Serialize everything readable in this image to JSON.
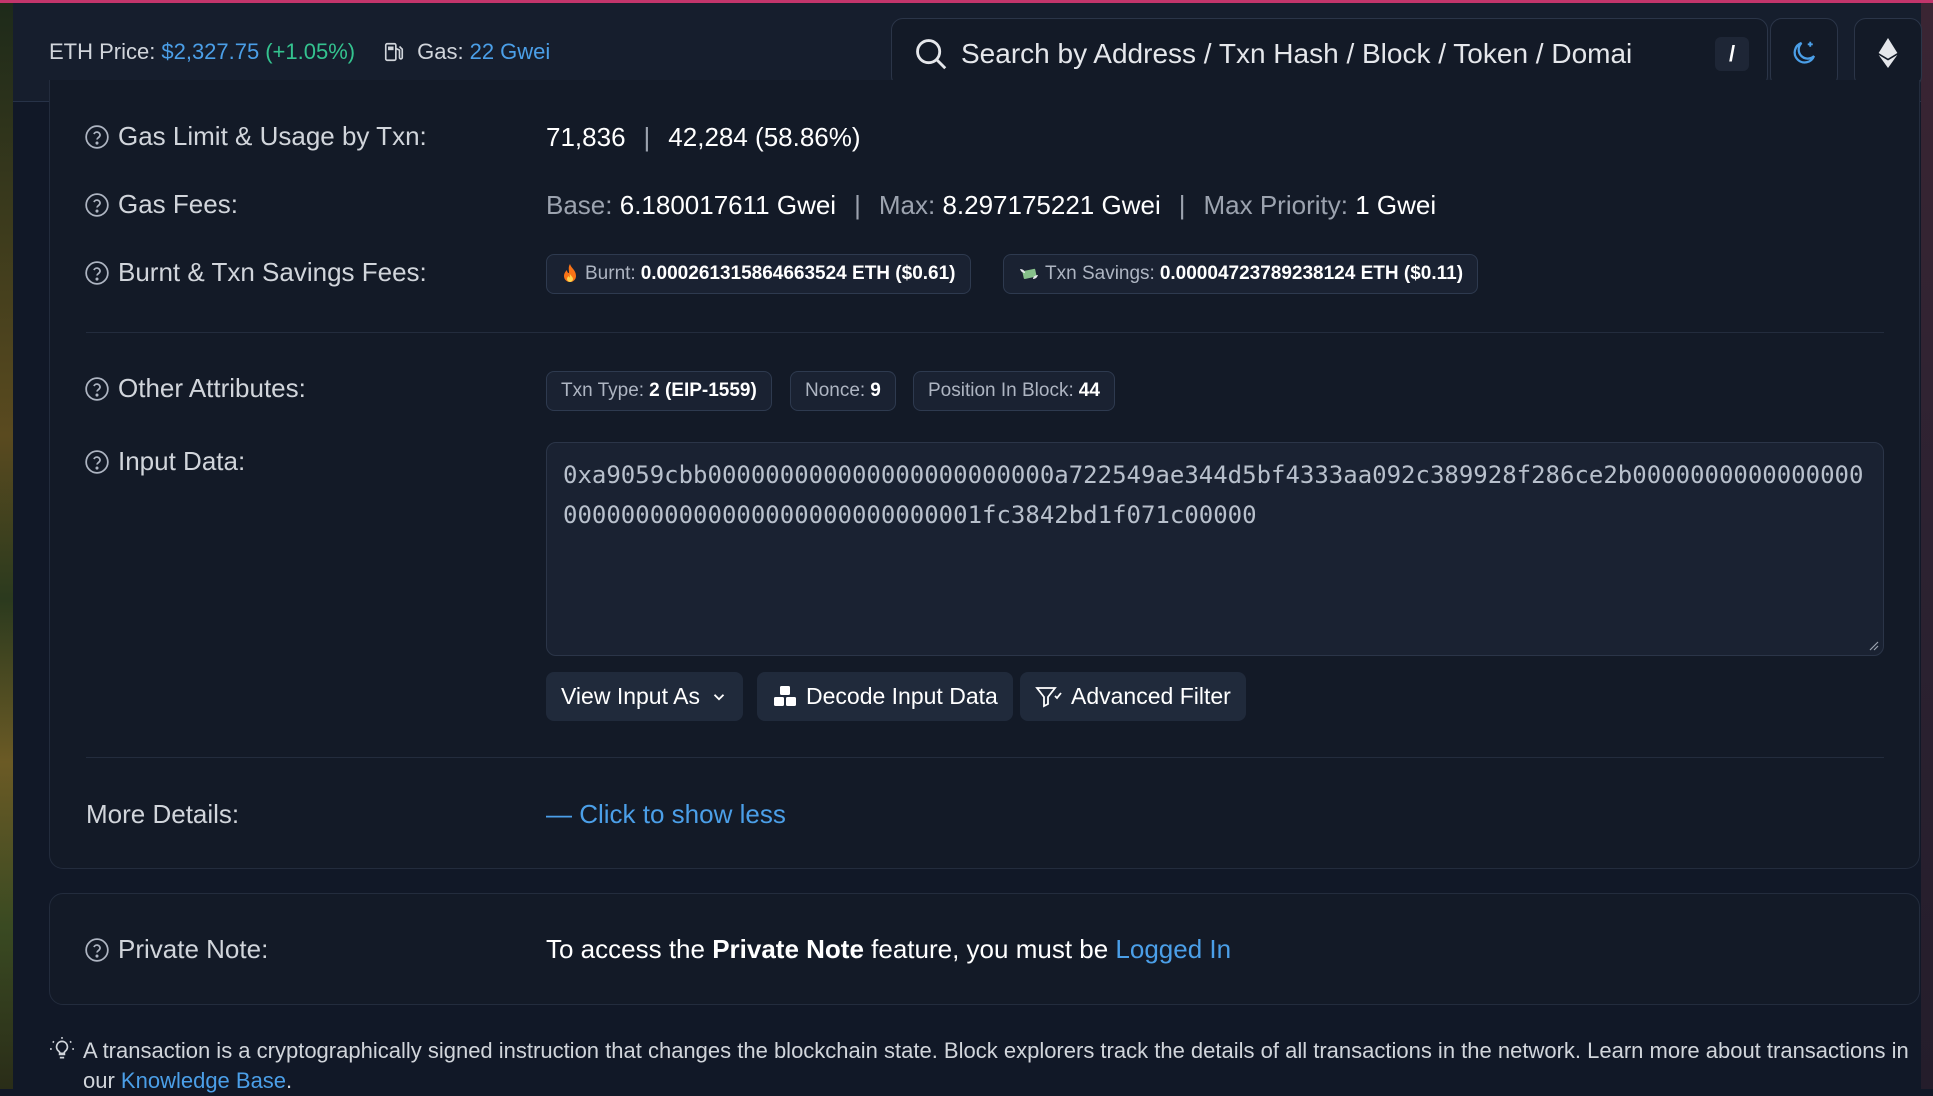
{
  "header": {
    "eth_price_label": "ETH Price:",
    "eth_price_value": "$2,327.75",
    "eth_price_change": "(+1.05%)",
    "gas_label": "Gas:",
    "gas_value": "22 Gwei",
    "search_placeholder": "Search by Address / Txn Hash / Block / Token / Domai",
    "search_shortcut": "/"
  },
  "details": {
    "gas_limit_label": "Gas Limit & Usage by Txn:",
    "gas_limit": "71,836",
    "gas_usage": "42,284 (58.86%)",
    "gas_fees_label": "Gas Fees:",
    "base_label": "Base:",
    "base_value": "6.180017611 Gwei",
    "max_label": "Max:",
    "max_value": "8.297175221 Gwei",
    "max_priority_label": "Max Priority:",
    "max_priority_value": "1 Gwei",
    "burnt_savings_label": "Burnt & Txn Savings Fees:",
    "burnt_label": "Burnt:",
    "burnt_value": "0.000261315864663524 ETH ($0.61)",
    "savings_label": "Txn Savings:",
    "savings_value": "0.00004723789238124 ETH ($0.11)",
    "other_attributes_label": "Other Attributes:",
    "txn_type_label": "Txn Type:",
    "txn_type_value": "2 (EIP-1559)",
    "nonce_label": "Nonce:",
    "nonce_value": "9",
    "position_label": "Position In Block:",
    "position_value": "44",
    "input_data_label": "Input Data:",
    "input_data": "0xa9059cbb000000000000000000000000a722549ae344d5bf4333aa092c389928f286ce2b000000000000000000000000000000000000000000001fc3842bd1f071c00000",
    "view_input_as": "View Input As",
    "decode_input_data": "Decode Input Data",
    "advanced_filter": "Advanced Filter",
    "more_details_label": "More Details:",
    "show_less": "— Click to show less"
  },
  "private_note": {
    "label": "Private Note:",
    "text_pre": "To access the ",
    "text_bold": "Private Note",
    "text_mid": " feature, you must be ",
    "login_link": "Logged In"
  },
  "tip": {
    "text": "A transaction is a cryptographically signed instruction that changes the blockchain state. Block explorers track the details of all transactions in the network. Learn more about transactions in our ",
    "link": "Knowledge Base",
    "end": "."
  },
  "colors": {
    "accent": "#4b9fe8",
    "positive": "#34c38f",
    "background": "#111827",
    "card": "#131a27"
  }
}
